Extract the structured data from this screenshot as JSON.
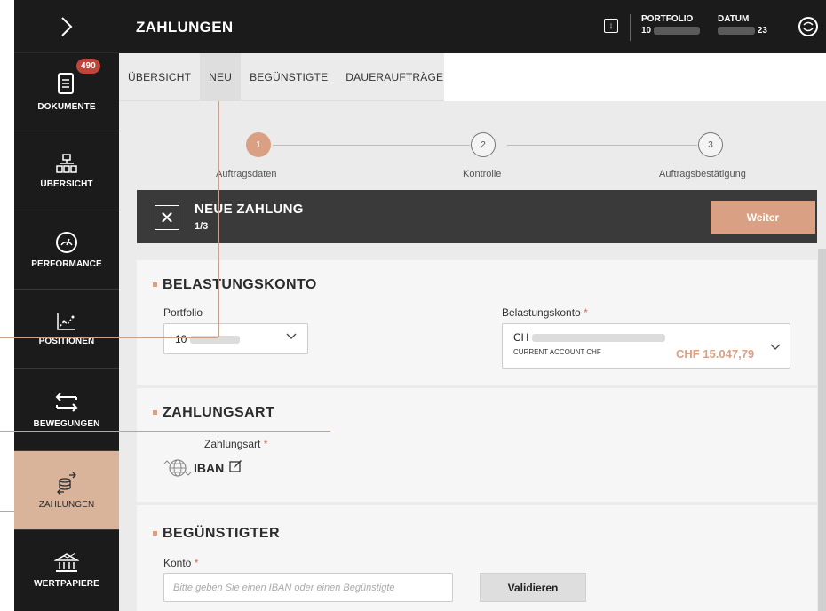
{
  "sidebar": {
    "items": [
      {
        "label": "DOKUMENTE",
        "badge": "490",
        "icon": "document-icon"
      },
      {
        "label": "ÜBERSICHT",
        "icon": "hierarchy-icon"
      },
      {
        "label": "PERFORMANCE",
        "icon": "gauge-icon"
      },
      {
        "label": "POSITIONEN",
        "icon": "chart-icon"
      },
      {
        "label": "BEWEGUNGEN",
        "icon": "transfer-arrows-icon"
      },
      {
        "label": "ZAHLUNGEN",
        "icon": "payment-icon",
        "active": true
      },
      {
        "label": "WERTPAPIERE",
        "icon": "securities-icon"
      }
    ]
  },
  "topbar": {
    "title": "ZAHLUNGEN",
    "portfolio_label": "PORTFOLIO",
    "portfolio_value": "10",
    "datum_label": "DATUM",
    "datum_value": "23"
  },
  "tabs": [
    "ÜBERSICHT",
    "NEU",
    "BEGÜNSTIGTE",
    "DAUERAUFTRÄGE"
  ],
  "active_tab": "NEU",
  "stepper": {
    "steps": [
      {
        "number": "1",
        "label": "Auftragsdaten",
        "done": true
      },
      {
        "number": "2",
        "label": "Kontrolle",
        "done": false
      },
      {
        "number": "3",
        "label": "Auftragsbestätigung",
        "done": false
      }
    ]
  },
  "header": {
    "title": "NEUE ZAHLUNG",
    "step": "1/3",
    "weiter_label": "Weiter"
  },
  "belastungskonto": {
    "title": "BELASTUNGSKONTO",
    "portfolio_label": "Portfolio",
    "portfolio_value": "10",
    "konto_label": "Belastungskonto",
    "konto_iban_prefix": "CH",
    "konto_type": "CURRENT ACCOUNT CHF",
    "konto_balance": "CHF 15.047,79"
  },
  "zahlungsart": {
    "title": "ZAHLUNGSART",
    "label": "Zahlungsart",
    "value": "IBAN"
  },
  "beguenstigter": {
    "title": "BEGÜNSTIGTER",
    "konto_label": "Konto",
    "konto_placeholder": "Bitte geben Sie einen IBAN oder einen Begünstigte",
    "validate_label": "Validieren"
  },
  "colors": {
    "accent": "#d9a084",
    "sidebar_bg": "#1b1b1b",
    "active_nav": "#d9b39a",
    "badge": "#c0443a"
  }
}
